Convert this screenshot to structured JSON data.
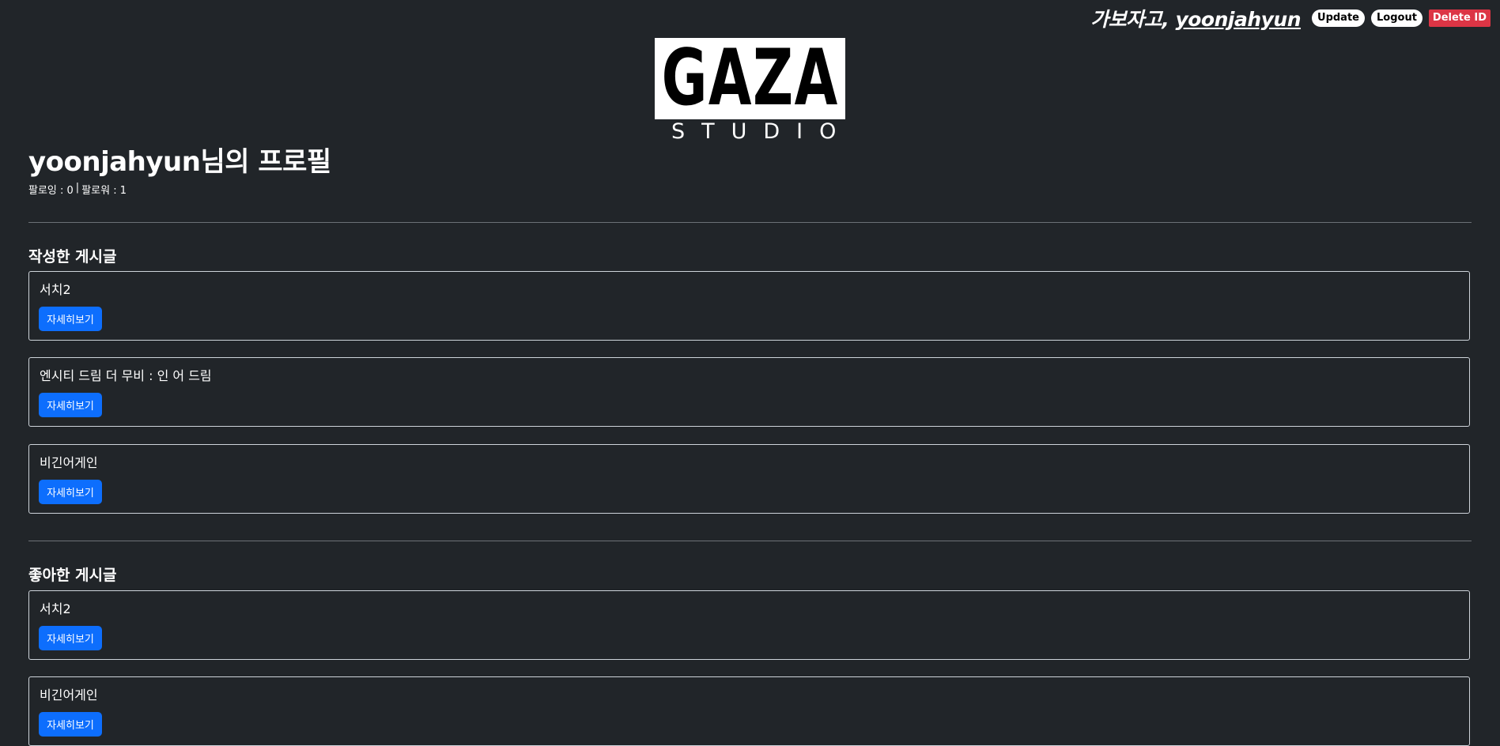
{
  "header": {
    "greeting_prefix": "가보자고, ",
    "username": "yoonjahyun",
    "update_label": "Update",
    "logout_label": "Logout",
    "delete_label": "Delete ID"
  },
  "logo": {
    "main_text": "GAZA",
    "sub_text": "STUDIO"
  },
  "profile": {
    "title": "yoonjahyun님의 프로필",
    "following_label": "팔로잉 : 0",
    "separator": "|",
    "followers_label": "팔로워 : 1"
  },
  "written_posts": {
    "heading": "작성한 게시글",
    "items": [
      {
        "title": "서치2",
        "button_label": "자세히보기"
      },
      {
        "title": "엔시티 드림 더 무비 : 인 어 드림",
        "button_label": "자세히보기"
      },
      {
        "title": "비긴어게인",
        "button_label": "자세히보기"
      }
    ]
  },
  "liked_posts": {
    "heading": "좋아한 게시글",
    "items": [
      {
        "title": "서치2",
        "button_label": "자세히보기"
      },
      {
        "title": "비긴어게인",
        "button_label": "자세히보기"
      }
    ]
  },
  "colors": {
    "background": "#212529",
    "primary_button": "#0d6efd",
    "danger_button": "#dc3545"
  }
}
